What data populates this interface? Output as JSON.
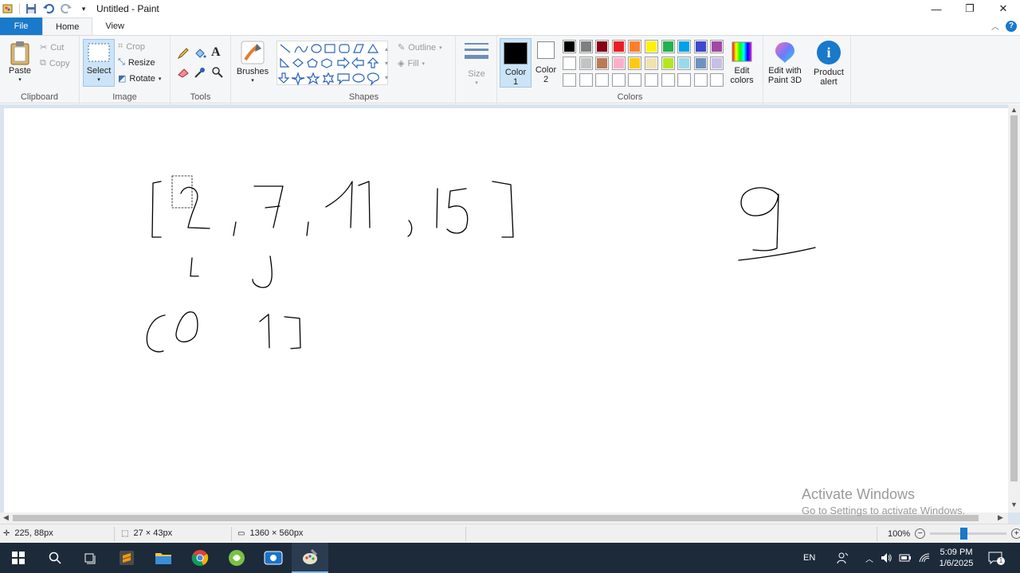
{
  "window": {
    "title": "Untitled - Paint",
    "controls": {
      "minimize": "—",
      "maximize": "❐",
      "close": "✕"
    }
  },
  "tabs": {
    "file": "File",
    "home": "Home",
    "view": "View"
  },
  "ribbon": {
    "clipboard": {
      "label": "Clipboard",
      "paste": "Paste",
      "cut": "Cut",
      "copy": "Copy"
    },
    "image": {
      "label": "Image",
      "select": "Select",
      "crop": "Crop",
      "resize": "Resize",
      "rotate": "Rotate"
    },
    "tools": {
      "label": "Tools"
    },
    "brushes": {
      "label": "Brushes"
    },
    "shapes": {
      "label": "Shapes",
      "outline": "Outline",
      "fill": "Fill"
    },
    "size": {
      "label": "Size"
    },
    "colors": {
      "label": "Colors",
      "color1": "Color\n1",
      "color1_l1": "Color",
      "color1_l2": "1",
      "color2_l1": "Color",
      "color2_l2": "2",
      "edit_l1": "Edit",
      "edit_l2": "colors",
      "color1_value": "#000000",
      "color2_value": "#ffffff",
      "palette_row1": [
        "#000000",
        "#7f7f7f",
        "#880015",
        "#ed1c24",
        "#ff7f27",
        "#fff200",
        "#22b14c",
        "#00a2e8",
        "#3f48cc",
        "#a349a4"
      ],
      "palette_row2": [
        "#ffffff",
        "#c3c3c3",
        "#b97a57",
        "#ffaec9",
        "#ffc90e",
        "#efe4b0",
        "#b5e61d",
        "#99d9ea",
        "#7092be",
        "#c8bfe7"
      ],
      "palette_row3": [
        "#ffffff",
        "#ffffff",
        "#ffffff",
        "#ffffff",
        "#ffffff",
        "#ffffff",
        "#ffffff",
        "#ffffff",
        "#ffffff",
        "#ffffff"
      ]
    },
    "paint3d": {
      "l1": "Edit with",
      "l2": "Paint 3D"
    },
    "product_alert": {
      "l1": "Product",
      "l2": "alert"
    }
  },
  "watermark": {
    "line1": "Activate Windows",
    "line2": "Go to Settings to activate Windows."
  },
  "status": {
    "cursor_pos": "225, 88px",
    "selection_size": "27 × 43px",
    "image_size": "1360 × 560px",
    "zoom": "100%"
  },
  "taskbar": {
    "lang": "EN",
    "time": "5:09 PM",
    "date": "1/6/2025",
    "notification_count": "1"
  }
}
